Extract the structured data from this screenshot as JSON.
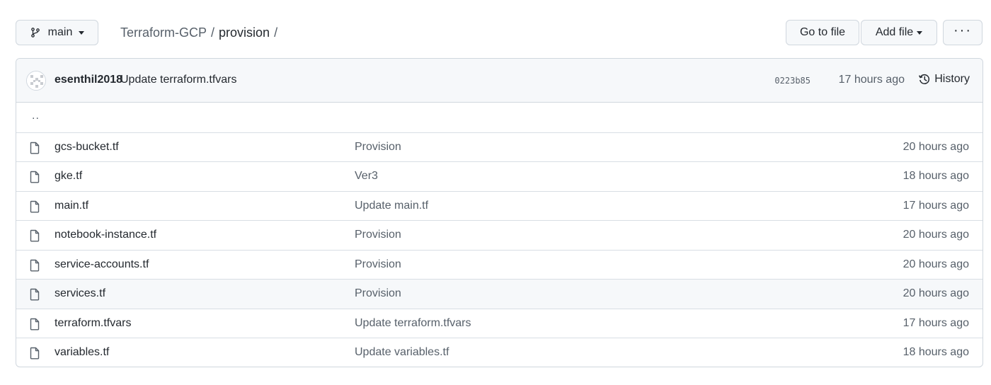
{
  "toolbar": {
    "branch": "main",
    "go_to_file": "Go to file",
    "add_file": "Add file",
    "more": "···"
  },
  "breadcrumb": {
    "repo": "Terraform-GCP",
    "sep1": "/",
    "dir": "provision",
    "sep2": "/"
  },
  "commit": {
    "author": "esenthil2018",
    "message": "Update terraform.tfvars",
    "sha": "0223b85",
    "time": "17 hours ago",
    "history_label": "History"
  },
  "parent_dir": "..",
  "files": [
    {
      "name": "gcs-bucket.tf",
      "message": "Provision",
      "age": "20 hours ago"
    },
    {
      "name": "gke.tf",
      "message": "Ver3",
      "age": "18 hours ago"
    },
    {
      "name": "main.tf",
      "message": "Update main.tf",
      "age": "17 hours ago"
    },
    {
      "name": "notebook-instance.tf",
      "message": "Provision",
      "age": "20 hours ago"
    },
    {
      "name": "service-accounts.tf",
      "message": "Provision",
      "age": "20 hours ago"
    },
    {
      "name": "services.tf",
      "message": "Provision",
      "age": "20 hours ago"
    },
    {
      "name": "terraform.tfvars",
      "message": "Update terraform.tfvars",
      "age": "17 hours ago"
    },
    {
      "name": "variables.tf",
      "message": "Update variables.tf",
      "age": "18 hours ago"
    }
  ],
  "icons": {
    "branch": "git-branch-icon",
    "file": "file-icon",
    "history": "history-clock-icon"
  },
  "colors": {
    "border": "#d0d7de",
    "header_bg": "#f6f8fa",
    "muted_text": "#57606a",
    "text": "#24292f"
  }
}
